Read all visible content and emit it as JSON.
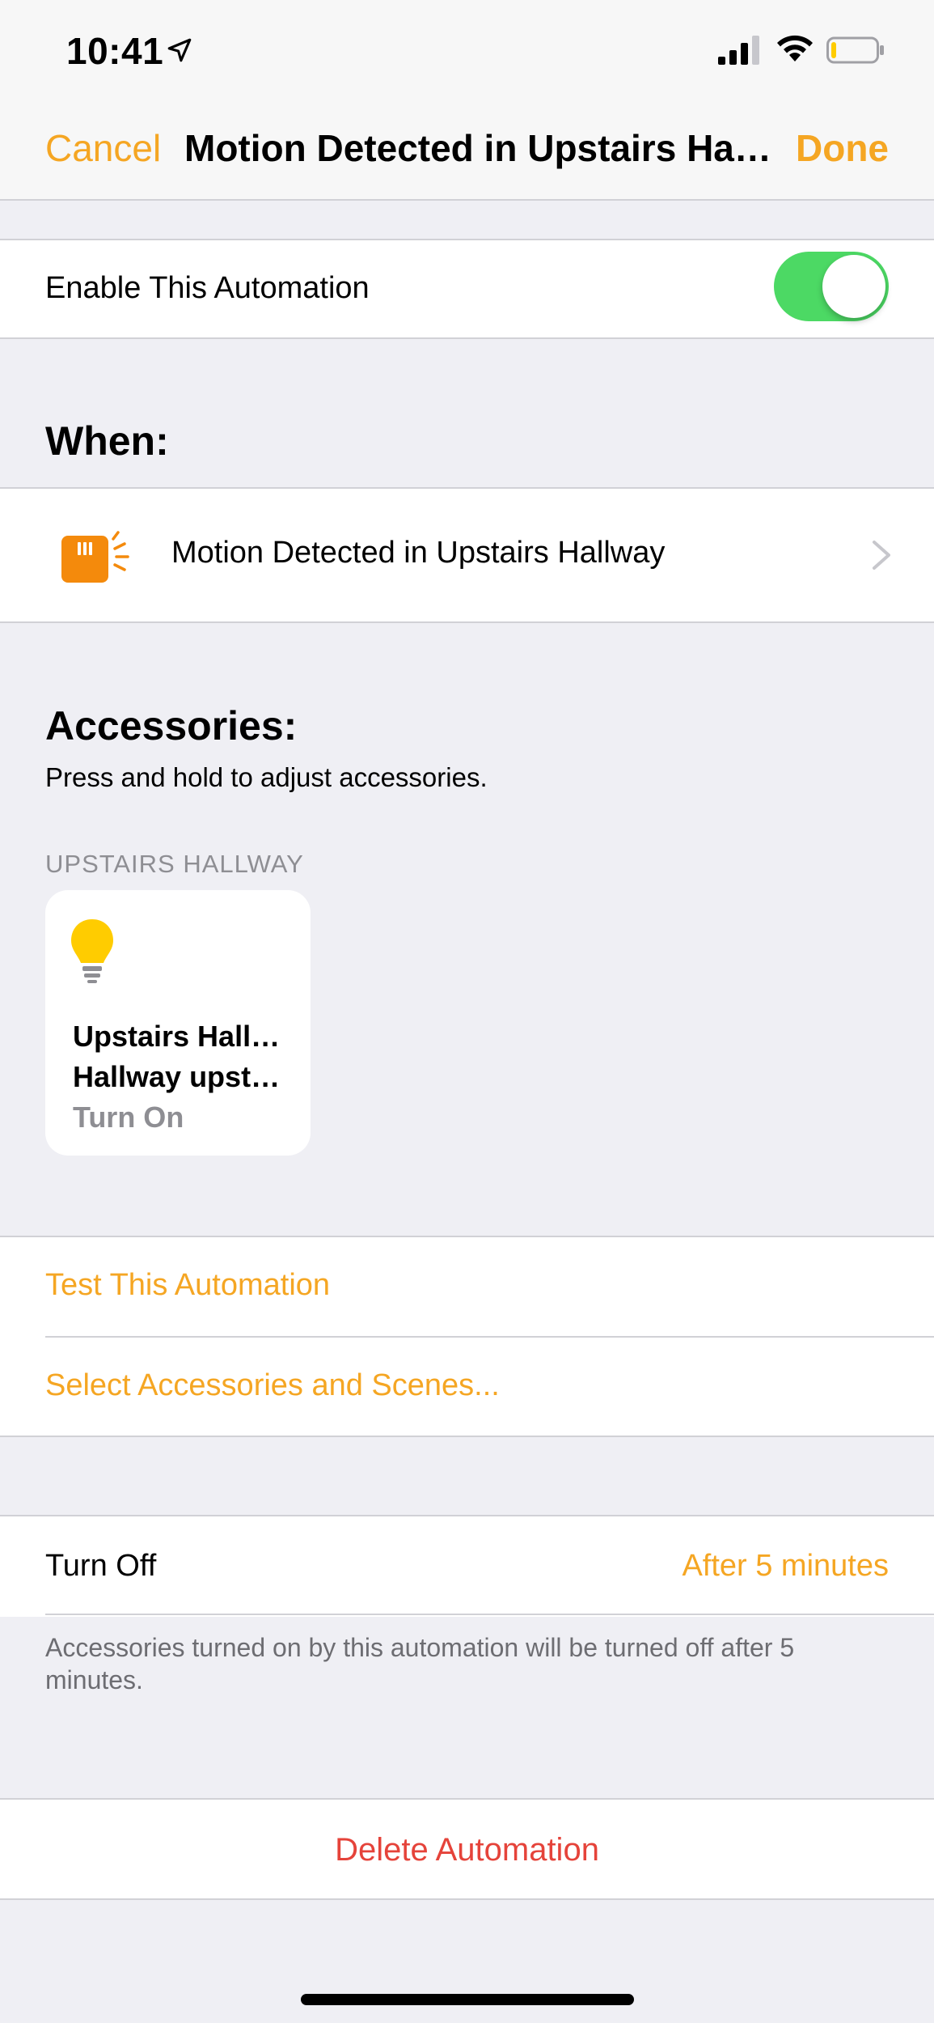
{
  "status_bar": {
    "time": "10:41",
    "icons": [
      "location-arrow-icon",
      "cellular-signal-icon",
      "wifi-icon",
      "battery-icon"
    ]
  },
  "nav": {
    "cancel_label": "Cancel",
    "title": "Motion Detected in Upstairs Hallway",
    "done_label": "Done"
  },
  "enable": {
    "label": "Enable This Automation",
    "enabled": true
  },
  "when": {
    "header": "When:",
    "trigger_label": "Motion Detected in Upstairs Hallway",
    "trigger_icon": "motion-sensor-icon"
  },
  "accessories": {
    "header": "Accessories:",
    "subtitle": "Press and hold to adjust accessories.",
    "group_caption": "UPSTAIRS HALLWAY",
    "tile": {
      "icon": "light-bulb-icon",
      "line1": "Upstairs Hallway",
      "line2": "Hallway upstairs",
      "state": "Turn On"
    }
  },
  "actions": {
    "test_label": "Test This Automation",
    "select_label": "Select Accessories and Scenes..."
  },
  "turn_off": {
    "label": "Turn Off",
    "value": "After 5 minutes",
    "footer": "Accessories turned on by this automation will be turned off after 5 minutes."
  },
  "delete_label": "Delete Automation",
  "colors": {
    "accent": "#f5a623",
    "toggle_on": "#4cd964",
    "destructive": "#e5433a",
    "background": "#efeff4"
  }
}
